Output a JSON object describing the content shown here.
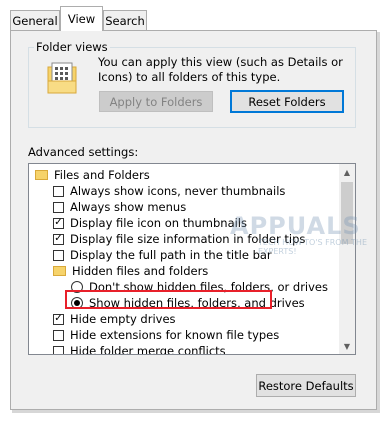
{
  "tabs": [
    {
      "label": "General"
    },
    {
      "label": "View"
    },
    {
      "label": "Search"
    }
  ],
  "folder_views": {
    "group_label": "Folder views",
    "description": "You can apply this view (such as Details or Icons) to all folders of this type.",
    "apply_button": "Apply to Folders",
    "reset_button": "Reset Folders"
  },
  "advanced": {
    "label": "Advanced settings:",
    "items": [
      {
        "type": "folder",
        "label": "Files and Folders"
      },
      {
        "type": "checkbox",
        "label": "Always show icons, never thumbnails",
        "checked": false
      },
      {
        "type": "checkbox",
        "label": "Always show menus",
        "checked": false
      },
      {
        "type": "checkbox",
        "label": "Display file icon on thumbnails",
        "checked": true
      },
      {
        "type": "checkbox",
        "label": "Display file size information in folder tips",
        "checked": true
      },
      {
        "type": "checkbox",
        "label": "Display the full path in the title bar",
        "checked": false
      },
      {
        "type": "folder",
        "label": "Hidden files and folders"
      },
      {
        "type": "radio",
        "label": "Don't show hidden files, folders, or drives",
        "checked": false
      },
      {
        "type": "radio",
        "label": "Show hidden files, folders, and drives",
        "checked": true
      },
      {
        "type": "checkbox",
        "label": "Hide empty drives",
        "checked": true
      },
      {
        "type": "checkbox",
        "label": "Hide extensions for known file types",
        "checked": false
      },
      {
        "type": "checkbox",
        "label": "Hide folder merge conflicts",
        "checked": false
      }
    ]
  },
  "restore_button": "Restore Defaults",
  "checkmark": "✓",
  "watermark": {
    "brand": "APPUALS",
    "tagline": "TECH HOW-TO'S FROM THE EXPERTS!"
  }
}
